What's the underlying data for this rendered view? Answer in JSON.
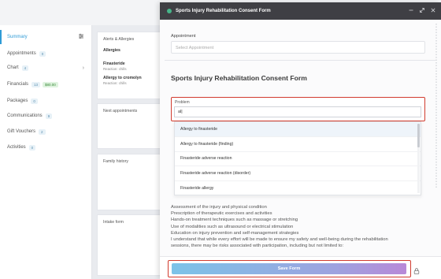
{
  "sidebar": {
    "items": [
      {
        "label": "Summary",
        "count": "",
        "money": ""
      },
      {
        "label": "Appointments",
        "count": "0",
        "money": ""
      },
      {
        "label": "Chart",
        "count": "4",
        "money": ""
      },
      {
        "label": "Financials",
        "count": "13",
        "money": "$80.00"
      },
      {
        "label": "Packages",
        "count": "0",
        "money": ""
      },
      {
        "label": "Communications",
        "count": "9",
        "money": ""
      },
      {
        "label": "Gift Vouchers",
        "count": "2",
        "money": ""
      },
      {
        "label": "Activities",
        "count": "0",
        "money": ""
      }
    ]
  },
  "cards": {
    "allergies": {
      "title": "Alerts & Allergies",
      "subtitle": "Allergies",
      "items": [
        {
          "name": "Finasteride",
          "reaction": "Reaction: chills"
        },
        {
          "name": "Allergy to cromolyn",
          "reaction": "Reaction: chills"
        }
      ]
    },
    "next_appointments": "Next appointments",
    "family_history": "Family history",
    "intake_form": "Intake form"
  },
  "modal": {
    "title": "Sports Injury Rehabilitation Consent Form",
    "appointment_label": "Appointment",
    "appointment_placeholder": "Select Appointment",
    "form_title": "Sports Injury Rehabilitation Consent Form",
    "problem_label": "Problem",
    "problem_value": "al|",
    "suggestions": [
      "Allergy to finasteride",
      "Allergy to finasteride (finding)",
      "Finasteride adverse reaction",
      "Finasteride adverse reaction (disorder)",
      "Finasteride allergy"
    ],
    "description_lines": [
      "Assessment of the injury and physical condition",
      "Prescription of therapeutic exercises and activities",
      "Hands-on treatment techniques such as massage or stretching",
      "Use of modalities such as ultrasound or electrical stimulation",
      "Education on injury prevention and self-management strategies",
      "I understand that while every effort will be made to ensure my safety and well-being during the rehabilitation",
      "sessions, there may be risks associated with participation, including but not limited to:"
    ],
    "save_label": "Save Form"
  },
  "colors": {
    "accent": "#2f9bd6",
    "header": "#3f3f44",
    "highlight": "#d13b2e"
  }
}
